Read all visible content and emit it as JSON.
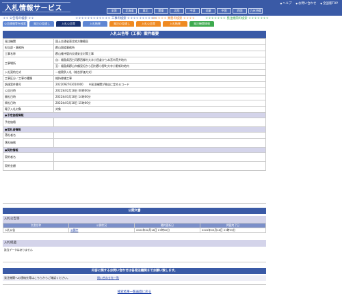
{
  "header": {
    "logo": "入札情報サービス",
    "links": [
      "ヘルプ",
      "お問い合わせ",
      "全国版TOP"
    ],
    "regions": [
      "全国",
      "北海道",
      "東北",
      "関東",
      "北陸",
      "中部",
      "近畿",
      "中国",
      "四国",
      "九州沖縄"
    ]
  },
  "categories": {
    "c1": "＊＊ 公告等の検索 ＊＊",
    "c2": "＊＊＊＊＊＊＊＊＊＊＊＊ 工事の検索 ＊＊＊＊＊＊＊＊＊＊",
    "c3": "＊＊＊＊＊ 業務の検索 ＊＊＊＊",
    "c4": "＊＊＊＊＊＊＊ 発注機関の検索 ＊＊＊＊＊＊＊"
  },
  "tabs": [
    {
      "label": "公告情報等を検索",
      "style": "blue"
    },
    {
      "label": "発注の見通し",
      "style": "blue"
    },
    {
      "label": "入札公告等",
      "style": "active"
    },
    {
      "label": "入札結果",
      "style": "blue"
    },
    {
      "label": "発注の見通し",
      "style": "orange"
    },
    {
      "label": "入札公告等",
      "style": "orange"
    },
    {
      "label": "入札結果",
      "style": "orange"
    },
    {
      "label": "発注機関情報",
      "style": "green"
    }
  ],
  "detail": {
    "title": "入札公告等（工事）案件概要",
    "rows": [
      {
        "label": "発注機関",
        "value": "国土交通省東北地方整備局"
      },
      {
        "label": "担当部・事務所",
        "value": "郡山国道事務所"
      },
      {
        "label": "工事名称",
        "value": "郡山維持管内交通安全対策工事"
      },
      {
        "label": "工事場所",
        "value": "自：福島県西白河郡西郷村大字小田倉から本宮市荒井地内",
        "value2": "至：福島県郡山市鶴見坦から田村郡小野町大字小野新町地内",
        "tall": true
      },
      {
        "label": "入札契約方式",
        "value": "一般競争入札（総合評価方式）"
      },
      {
        "label": "工事区分／工事の種類",
        "value": "維持修繕工事"
      },
      {
        "label": "調達案件番号",
        "value": "2022092763010000　　※発注機関が独自に定めるコード"
      },
      {
        "label": "公告日時",
        "value": "2022年02月18日 00時00分"
      },
      {
        "label": "開札日時",
        "value": "2022年03月18日 14時00分"
      },
      {
        "label": "掲札日時",
        "value": "2022年03月18日 15時00分"
      },
      {
        "label": "電子入札対象",
        "value": "対象"
      }
    ],
    "sections": {
      "schedule": "●予定価格情報",
      "schedule_label": "予定価格",
      "bidder": "●落札者情報",
      "bidder_name": "落札者名",
      "bidder_price": "落札価格",
      "contract": "●契約情報",
      "contract_name": "契約者名",
      "contract_amount": "契約金額"
    }
  },
  "public_docs": {
    "title": "公開文書",
    "announce_head": "入札公告等",
    "columns": [
      "文書名称",
      "公開状況",
      "最終更新日",
      "掲載終了日"
    ],
    "rows": [
      {
        "name": "入札公告",
        "status": "公開中",
        "updated": "2022年02月18日 07時00分",
        "end": "2022年03月18日 23時59分"
      }
    ],
    "result_head": "入札経過",
    "no_data": "該当データはありません"
  },
  "contact": {
    "bar": "内容に関するお問い合わせは各発注機関までお願い致します。",
    "text": "発注機関への連絡先等はこちらからご確認ください。",
    "link": "問い合わせ先一覧"
  },
  "footer": {
    "back": "検索結果一覧画面に戻る"
  }
}
